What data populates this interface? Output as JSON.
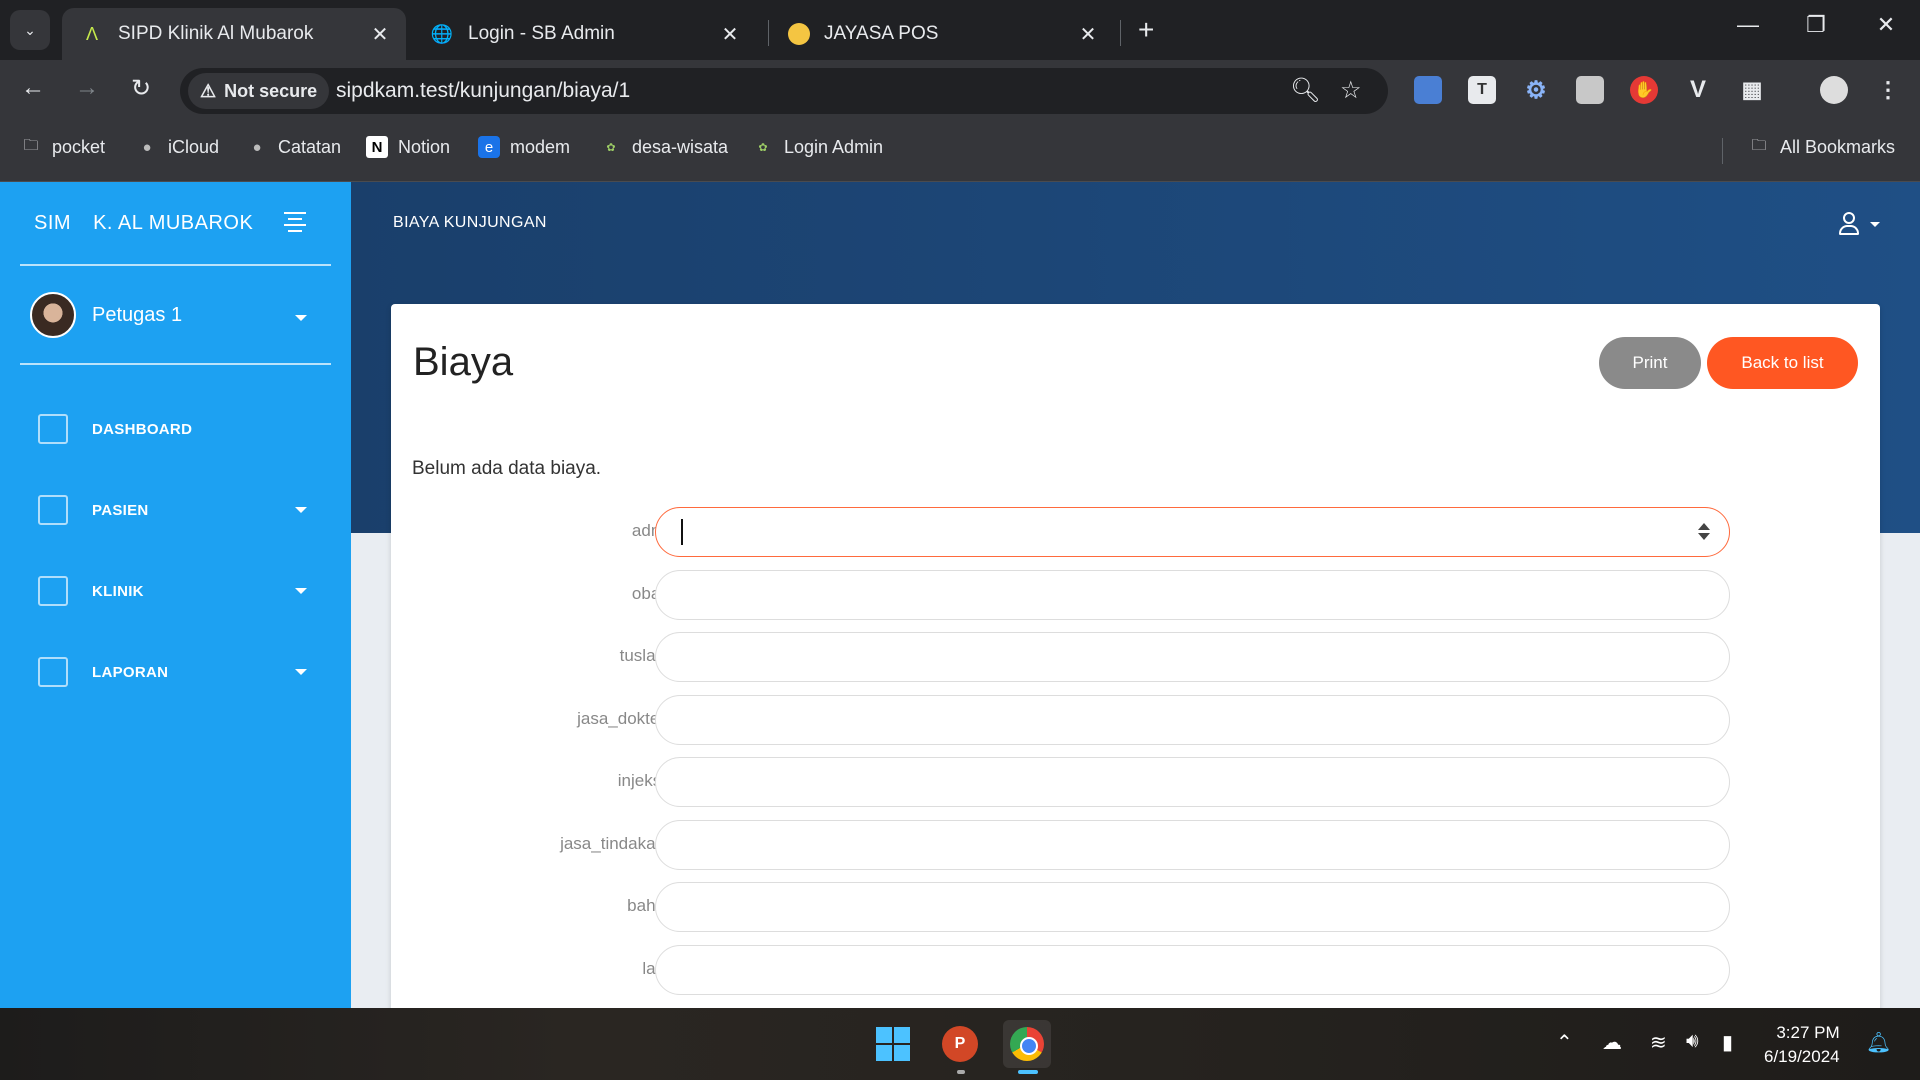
{
  "browser": {
    "tabs": [
      {
        "title": "SIPD Klinik Al Mubarok",
        "icon": "arc-icon"
      },
      {
        "title": "Login - SB Admin",
        "icon": "globe-icon"
      },
      {
        "title": "JAYASA POS",
        "icon": "pos-icon"
      }
    ],
    "security_label": "Not secure",
    "url": "sipdkam.test/kunjungan/biaya/1",
    "bookmarks": [
      {
        "label": "pocket",
        "icon": "folder-icon"
      },
      {
        "label": "iCloud",
        "icon": "apple-icon"
      },
      {
        "label": "Catatan",
        "icon": "apple-icon"
      },
      {
        "label": "Notion",
        "icon": "notion-icon"
      },
      {
        "label": "modem",
        "icon": "modem-icon"
      },
      {
        "label": "desa-wisata",
        "icon": "leaf-icon"
      },
      {
        "label": "Login Admin",
        "icon": "leaf-icon"
      }
    ],
    "all_bookmarks": "All Bookmarks"
  },
  "sidebar": {
    "brand_short": "SIM",
    "brand_name": "K. AL MUBAROK",
    "user_name": "Petugas 1",
    "items": [
      {
        "label": "DASHBOARD",
        "icon": "box-icon"
      },
      {
        "label": "PASIEN",
        "icon": "book-icon"
      },
      {
        "label": "KLINIK",
        "icon": "ambulance-icon"
      },
      {
        "label": "LAPORAN",
        "icon": "briefcase-icon"
      }
    ]
  },
  "header": {
    "title": "BIAYA KUNJUNGAN"
  },
  "card": {
    "title": "Biaya",
    "print_label": "Print",
    "back_label": "Back to list",
    "empty_message": "Belum ada data biaya."
  },
  "form": {
    "fields": [
      {
        "label": "adm",
        "value": ""
      },
      {
        "label": "obat",
        "value": ""
      },
      {
        "label": "tuslah",
        "value": ""
      },
      {
        "label": "jasa_dokter",
        "value": ""
      },
      {
        "label": "injeksi",
        "value": ""
      },
      {
        "label": "jasa_tindakan",
        "value": ""
      },
      {
        "label": "bahp",
        "value": ""
      },
      {
        "label": "lab",
        "value": ""
      }
    ]
  },
  "taskbar": {
    "time": "3:27 PM",
    "date": "6/19/2024"
  },
  "colors": {
    "sidebar": "#1da1f2",
    "topbar": "#1f4f85",
    "accent": "#ff5722",
    "print_button": "#8a8a8a"
  }
}
